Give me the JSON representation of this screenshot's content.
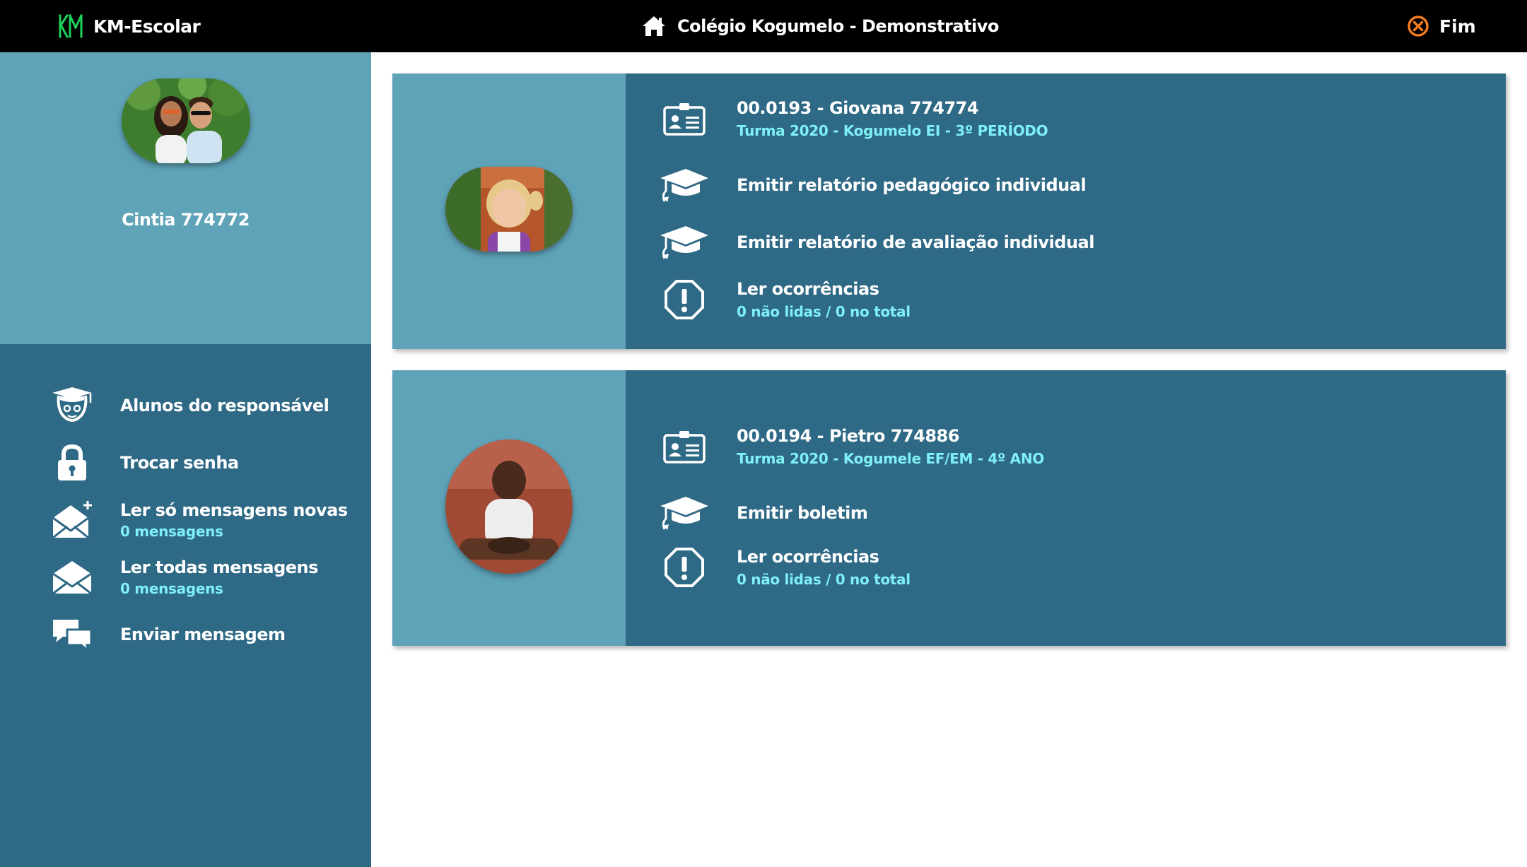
{
  "header": {
    "brand": "KM-Escolar",
    "school": "Colégio Kogumelo - Demonstrativo",
    "logout_label": "Fim",
    "brand_color": "#1bd15a",
    "logout_color": "#f27b1f"
  },
  "sidebar": {
    "guardian_name": "Cintia 774772",
    "items": [
      {
        "label": "Alunos do responsável",
        "sub": "",
        "icon": "student-cap-icon"
      },
      {
        "label": "Trocar senha",
        "sub": "",
        "icon": "lock-icon"
      },
      {
        "label": "Ler só mensagens novas",
        "sub": "0 mensagens",
        "icon": "envelope-plus-icon"
      },
      {
        "label": "Ler todas mensagens",
        "sub": "0 mensagens",
        "icon": "envelope-icon"
      },
      {
        "label": "Enviar mensagem",
        "sub": "",
        "icon": "chat-bubbles-icon"
      }
    ]
  },
  "students": [
    {
      "id_name": "00.0193 - Giovana 774774",
      "class": "Turma 2020 - Kogumelo EI - 3º PERÍODO",
      "actions": [
        {
          "label": "Emitir relatório pedagógico individual",
          "sub": ""
        },
        {
          "label": "Emitir relatório de avaliação individual",
          "sub": ""
        },
        {
          "label": "Ler ocorrências",
          "sub": "0 não lidas / 0 no total"
        }
      ]
    },
    {
      "id_name": "00.0194 - Pietro 774886",
      "class": "Turma 2020 - Kogumele EF/EM - 4º ANO",
      "actions": [
        {
          "label": "Emitir boletim",
          "sub": ""
        },
        {
          "label": "Ler ocorrências",
          "sub": "0 não lidas / 0 no total"
        }
      ]
    }
  ]
}
